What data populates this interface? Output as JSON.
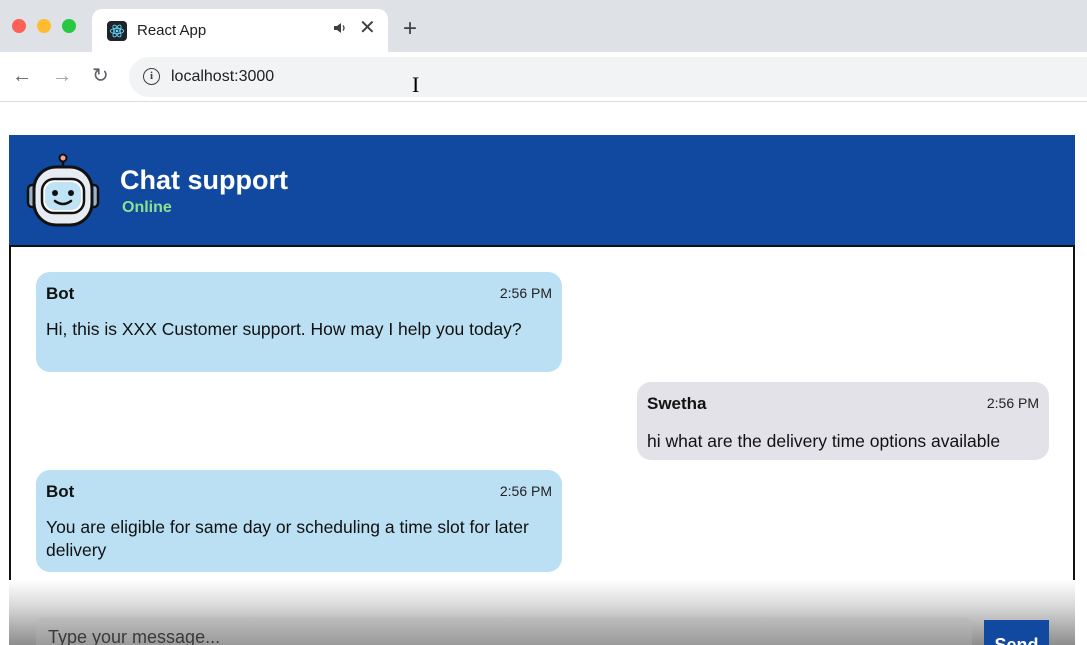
{
  "browser": {
    "tab_title": "React App",
    "tab_audio_icon": "speaker-icon",
    "tab_close": "✕",
    "new_tab": "+",
    "nav": {
      "back": "←",
      "forward": "→",
      "reload": "↻"
    },
    "url": "localhost:3000"
  },
  "chat": {
    "header": {
      "title": "Chat support",
      "status": "Online",
      "avatar_icon": "robot-icon",
      "header_color": "#1148a0",
      "status_color": "#8ae38f"
    },
    "messages": [
      {
        "sender": "Bot",
        "time": "2:56 PM",
        "text": "Hi, this is XXX Customer support. How may I help you today?",
        "from": "bot"
      },
      {
        "sender": "Swetha",
        "time": "2:56 PM",
        "text": "hi what are the delivery time options available",
        "from": "user"
      },
      {
        "sender": "Bot",
        "time": "2:56 PM",
        "text": "You are eligible for same day or scheduling a time slot for later delivery",
        "from": "bot"
      }
    ],
    "input": {
      "placeholder": "Type your message...",
      "value": ""
    },
    "send_label": "Send",
    "colors": {
      "bot_bubble": "#bbdff3",
      "user_bubble": "#e2e2e8"
    }
  }
}
